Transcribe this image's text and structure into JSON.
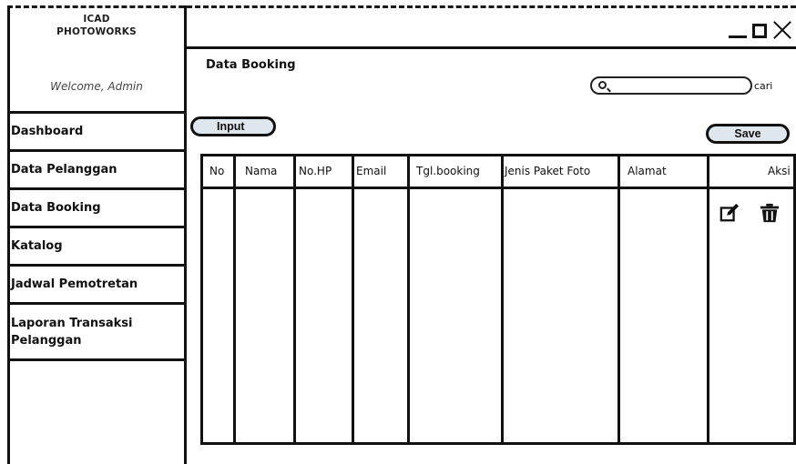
{
  "app": {
    "brand_line1": "ICAD",
    "brand_line2": "PHOTOWORKS",
    "welcome": "Welcome, Admin"
  },
  "sidebar": {
    "items": [
      {
        "label": "Dashboard"
      },
      {
        "label": "Data Pelanggan"
      },
      {
        "label": "Data Booking"
      },
      {
        "label": "Katalog"
      },
      {
        "label": "Jadwal Pemotretan"
      },
      {
        "label": "Laporan Transaksi Pelanggan"
      }
    ]
  },
  "window_controls": {
    "minimize_icon": "minimize-icon",
    "maximize_icon": "maximize-icon",
    "close_icon": "close-icon"
  },
  "main": {
    "title": "Data Booking",
    "search": {
      "value": "",
      "placeholder": "",
      "button_label": "cari"
    },
    "input_button": "Input",
    "save_button": "Save",
    "table": {
      "columns": [
        "No",
        "Nama",
        "No.HP",
        "Email",
        "Tgl.booking",
        "Jenis Paket Foto",
        "Alamat",
        "Aksi"
      ],
      "rows": [],
      "action_icons": [
        "edit-icon",
        "trash-icon"
      ]
    }
  }
}
